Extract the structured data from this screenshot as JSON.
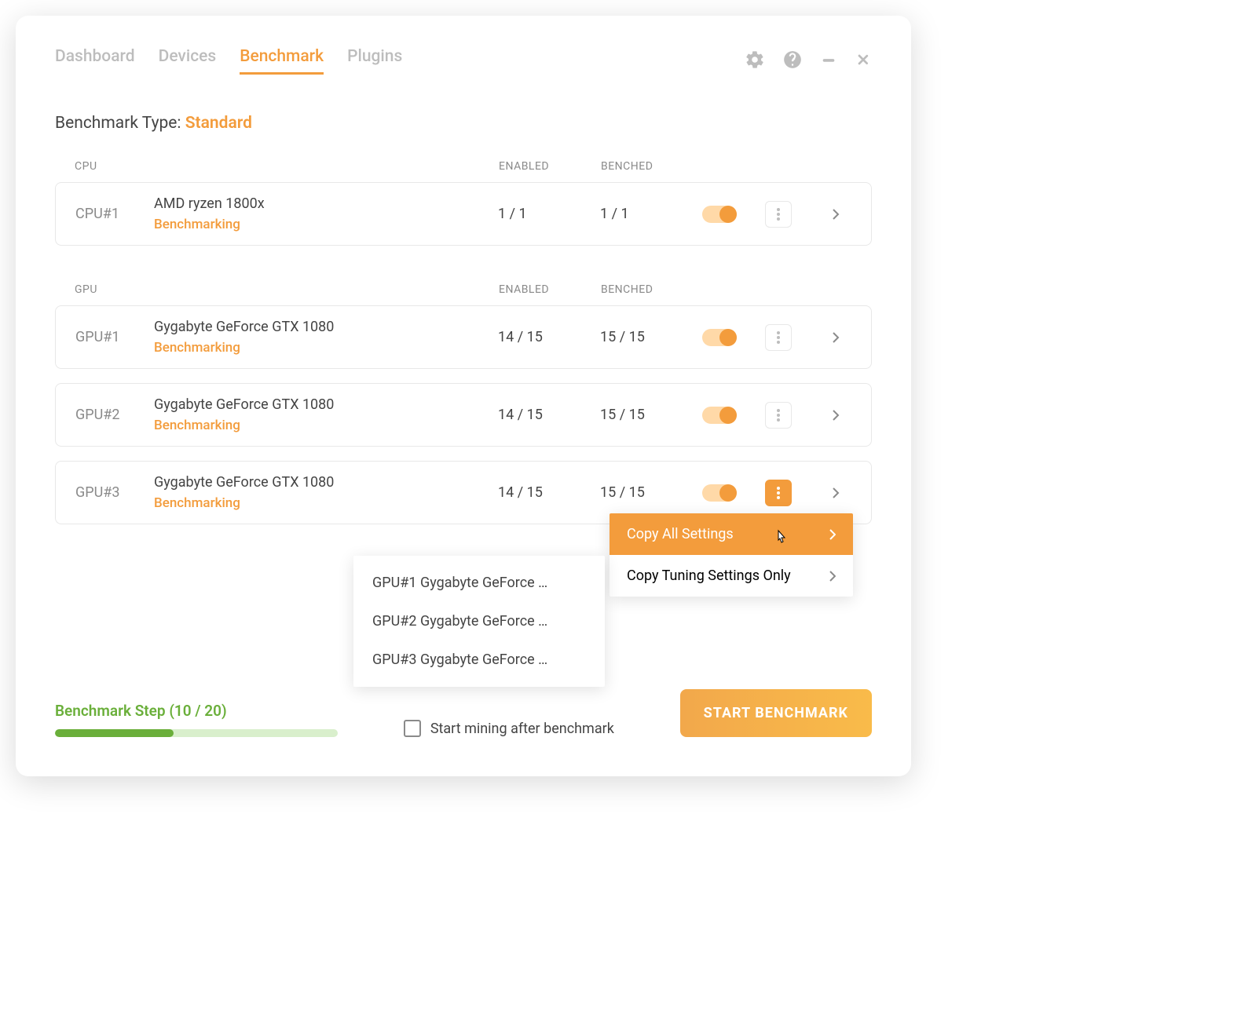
{
  "tabs": {
    "dashboard": "Dashboard",
    "devices": "Devices",
    "benchmark": "Benchmark",
    "plugins": "Plugins"
  },
  "benchmark_type_label": "Benchmark Type:",
  "benchmark_type_value": "Standard",
  "headers": {
    "cpu": "CPU",
    "gpu": "GPU",
    "enabled": "ENABLED",
    "benched": "BENCHED"
  },
  "cpu": [
    {
      "id": "CPU#1",
      "name": "AMD ryzen 1800x",
      "status": "Benchmarking",
      "enabled": "1 / 1",
      "benched": "1 / 1"
    }
  ],
  "gpu": [
    {
      "id": "GPU#1",
      "name": "Gygabyte GeForce GTX 1080",
      "status": "Benchmarking",
      "enabled": "14 / 15",
      "benched": "15 / 15"
    },
    {
      "id": "GPU#2",
      "name": "Gygabyte GeForce GTX 1080",
      "status": "Benchmarking",
      "enabled": "14 / 15",
      "benched": "15 / 15"
    },
    {
      "id": "GPU#3",
      "name": "Gygabyte GeForce GTX 1080",
      "status": "Benchmarking",
      "enabled": "14 / 15",
      "benched": "15 / 15"
    }
  ],
  "dropdown": {
    "copy_all": "Copy All Settings",
    "copy_tuning": "Copy Tuning Settings Only"
  },
  "sub_dropdown": [
    "GPU#1 Gygabyte GeForce …",
    "GPU#2 Gygabyte GeForce …",
    "GPU#3 Gygabyte GeForce …"
  ],
  "progress_label": "Benchmark Step (10 / 20)",
  "progress_pct": 50,
  "start_mining_label": "Start mining after benchmark",
  "start_button": "START BENCHMARK"
}
